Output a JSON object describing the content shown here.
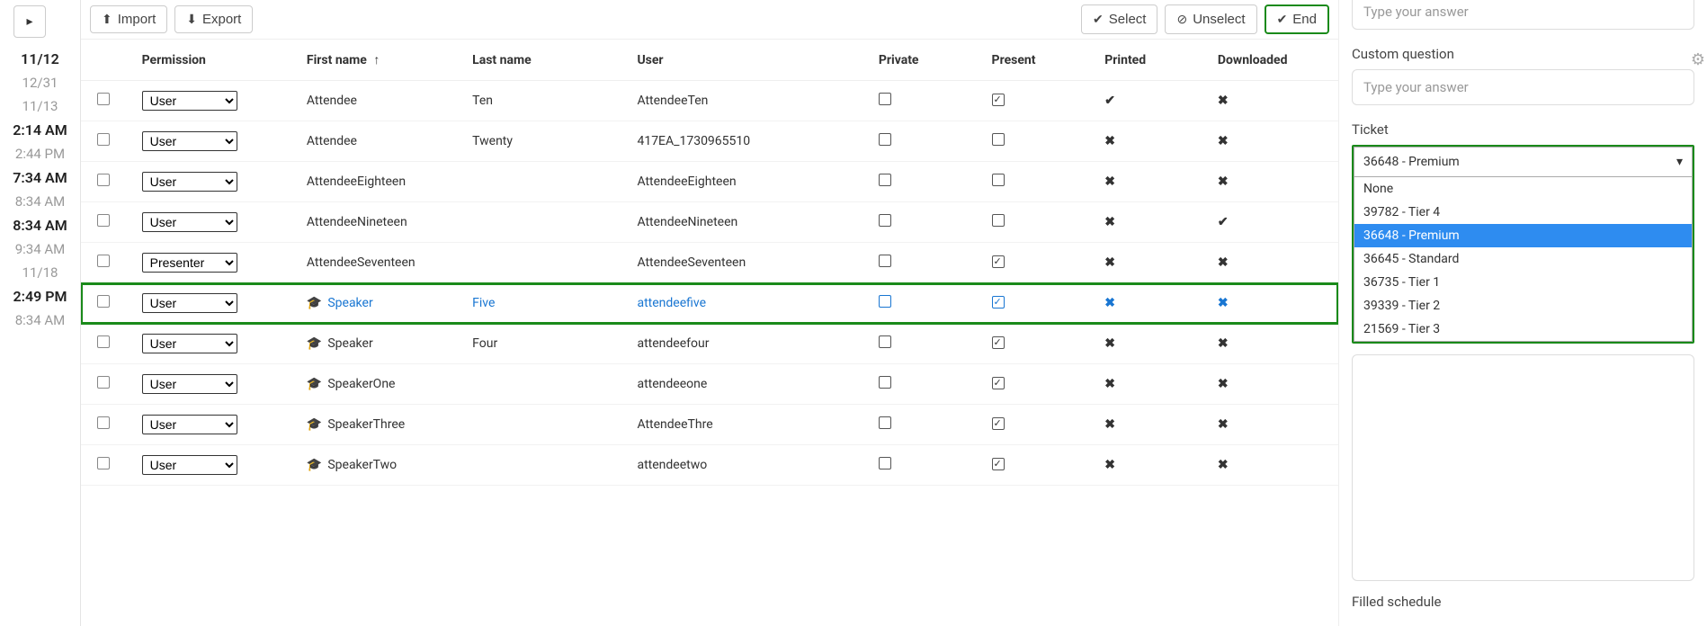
{
  "toolbar": {
    "import": "Import",
    "export": "Export",
    "select": "Select",
    "unselect": "Unselect",
    "end": "End"
  },
  "timeline": [
    {
      "text": "11/12",
      "style": "bold"
    },
    {
      "text": "12/31",
      "style": "muted"
    },
    {
      "text": "11/13",
      "style": "muted"
    },
    {
      "text": "2:14 AM",
      "style": "bold"
    },
    {
      "text": "2:44 PM",
      "style": "muted"
    },
    {
      "text": "7:34 AM",
      "style": "bold"
    },
    {
      "text": "8:34 AM",
      "style": "muted"
    },
    {
      "text": "8:34 AM",
      "style": "bold"
    },
    {
      "text": "9:34 AM",
      "style": "muted"
    },
    {
      "text": "11/18",
      "style": "muted"
    },
    {
      "text": "2:49 PM",
      "style": "bold"
    },
    {
      "text": "8:34 AM",
      "style": "muted"
    }
  ],
  "columns": {
    "permission": "Permission",
    "first_name": "First name",
    "last_name": "Last name",
    "user": "User",
    "private": "Private",
    "present": "Present",
    "printed": "Printed",
    "downloaded": "Downloaded"
  },
  "permission_options": {
    "user": "User",
    "presenter": "Presenter"
  },
  "rows": [
    {
      "perm": "User",
      "first": "Attendee",
      "last": "Ten",
      "user": "AttendeeTen",
      "private": false,
      "present": true,
      "printed": "check",
      "downloaded": "x",
      "speaker": false,
      "highlight": false
    },
    {
      "perm": "User",
      "first": "Attendee",
      "last": "Twenty",
      "user": "417EA_1730965510",
      "private": false,
      "present": false,
      "printed": "x",
      "downloaded": "x",
      "speaker": false,
      "highlight": false
    },
    {
      "perm": "User",
      "first": "AttendeeEighteen",
      "last": "",
      "user": "AttendeeEighteen",
      "private": false,
      "present": false,
      "printed": "x",
      "downloaded": "x",
      "speaker": false,
      "highlight": false
    },
    {
      "perm": "User",
      "first": "AttendeeNineteen",
      "last": "",
      "user": "AttendeeNineteen",
      "private": false,
      "present": false,
      "printed": "x",
      "downloaded": "check",
      "speaker": false,
      "highlight": false
    },
    {
      "perm": "Presenter",
      "first": "AttendeeSeventeen",
      "last": "",
      "user": "AttendeeSeventeen",
      "private": false,
      "present": true,
      "printed": "x",
      "downloaded": "x",
      "speaker": false,
      "highlight": false
    },
    {
      "perm": "User",
      "first": "Speaker",
      "last": "Five",
      "user": "attendeefive",
      "private": false,
      "present": true,
      "printed": "x",
      "downloaded": "x",
      "speaker": true,
      "highlight": true
    },
    {
      "perm": "User",
      "first": "Speaker",
      "last": "Four",
      "user": "attendeefour",
      "private": false,
      "present": true,
      "printed": "x",
      "downloaded": "x",
      "speaker": true,
      "highlight": false
    },
    {
      "perm": "User",
      "first": "SpeakerOne",
      "last": "",
      "user": "attendeeone",
      "private": false,
      "present": true,
      "printed": "x",
      "downloaded": "x",
      "speaker": true,
      "highlight": false
    },
    {
      "perm": "User",
      "first": "SpeakerThree",
      "last": "",
      "user": "AttendeeThre",
      "private": false,
      "present": true,
      "printed": "x",
      "downloaded": "x",
      "speaker": true,
      "highlight": false
    },
    {
      "perm": "User",
      "first": "SpeakerTwo",
      "last": "",
      "user": "attendeetwo",
      "private": false,
      "present": true,
      "printed": "x",
      "downloaded": "x",
      "speaker": true,
      "highlight": false
    }
  ],
  "sidepanel": {
    "answer_placeholder": "Type your answer",
    "custom_question_label": "Custom question",
    "ticket_label": "Ticket",
    "ticket_selected": "36648 - Premium",
    "ticket_options": [
      "None",
      "39782 - Tier 4",
      "36648 - Premium",
      "36645 - Standard",
      "36735 - Tier 1",
      "39339 - Tier 2",
      "21569 - Tier 3"
    ],
    "filled_schedule": "Filled schedule"
  }
}
